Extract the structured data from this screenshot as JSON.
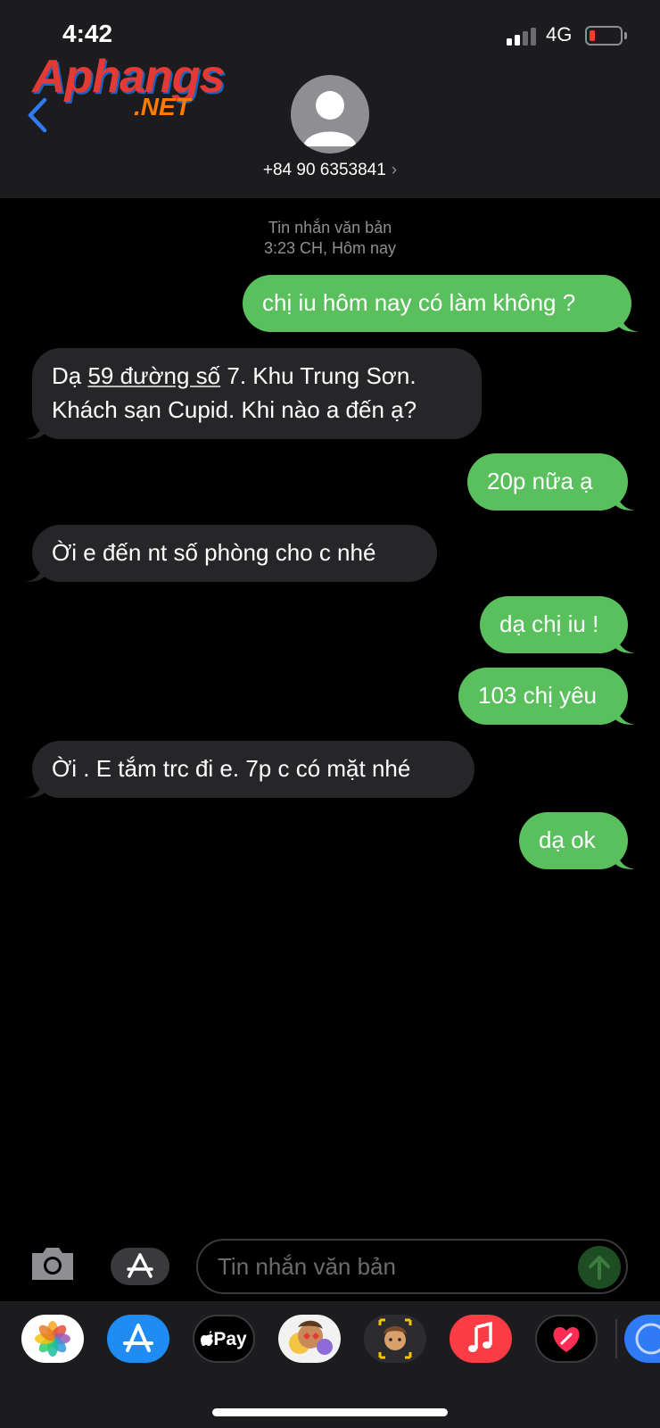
{
  "status_bar": {
    "time": "4:42",
    "network": "4G"
  },
  "watermark": {
    "main": "Aphangs",
    "sub": ".NET"
  },
  "contact": {
    "phone": "+84 90 6353841",
    "chevron": "›"
  },
  "thread_meta": {
    "label": "Tin nhắn văn bản",
    "time": "3:23 CH, Hôm nay"
  },
  "messages": [
    {
      "dir": "sent",
      "text": "chị iu hôm nay có làm không ?"
    },
    {
      "dir": "recv",
      "line1_pre": "Dạ ",
      "line1_link": "59 đường số",
      "line1_post": " 7. Khu Trung Sơn.",
      "line2": "Khách sạn Cupid.  Khi nào a đến ạ?"
    },
    {
      "dir": "sent",
      "text": "20p nữa ạ"
    },
    {
      "dir": "recv",
      "text": "Ời e đến nt số phòng cho c nhé"
    },
    {
      "dir": "sent",
      "text": "dạ chị iu !"
    },
    {
      "dir": "sent",
      "text": "103 chị yêu"
    },
    {
      "dir": "recv",
      "text": "Ời . E tắm trc đi e. 7p c có mặt nhé"
    },
    {
      "dir": "sent",
      "text": "dạ ok"
    }
  ],
  "composer": {
    "placeholder": "Tin nhắn văn bản"
  },
  "dock_apps": [
    {
      "icon": "photos-icon"
    },
    {
      "icon": "app-store-icon"
    },
    {
      "icon": "apple-pay-icon",
      "label": "Pay"
    },
    {
      "icon": "memoji-stickers-icon"
    },
    {
      "icon": "memoji-icon"
    },
    {
      "icon": "music-icon"
    },
    {
      "icon": "digital-touch-icon"
    },
    {
      "icon": "more-apps-icon"
    }
  ],
  "colors": {
    "sent_bubble": "#5ac05e",
    "recv_bubble": "#262628",
    "accent": "#2f7bf5",
    "header": "#1c1c1e"
  }
}
